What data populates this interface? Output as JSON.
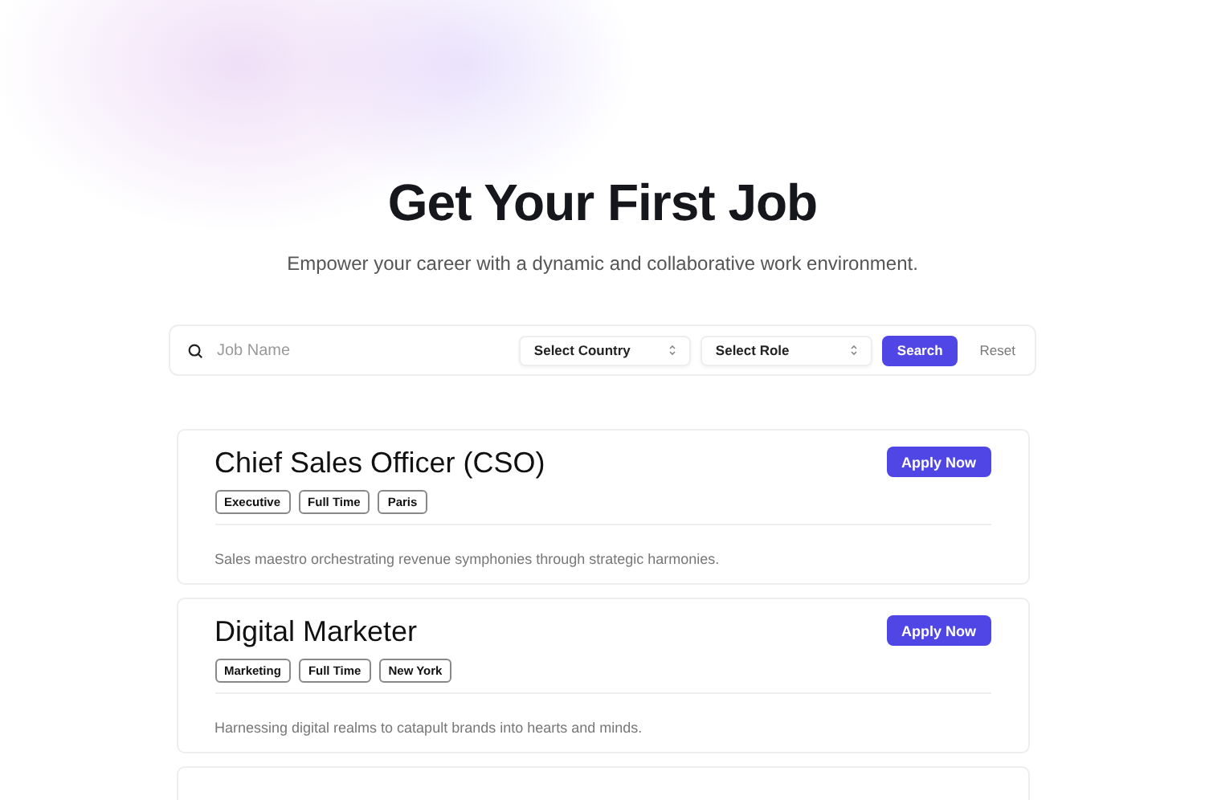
{
  "hero": {
    "title": "Get Your First Job",
    "subtitle": "Empower your career with a dynamic and collaborative work environment."
  },
  "search": {
    "placeholder": "Job Name",
    "selects": [
      "Select Country",
      "Select Role"
    ],
    "search_button": "Search",
    "reset_button": "Reset"
  },
  "jobs": [
    {
      "title": "Chief Sales Officer (CSO)",
      "tags": [
        "Executive",
        "Full Time",
        "Paris"
      ],
      "description": "Sales maestro orchestrating revenue symphonies through strategic harmonies.",
      "button": "Apply Now"
    },
    {
      "title": "Digital Marketer",
      "tags": [
        "Marketing",
        "Full Time",
        "New York"
      ],
      "description": "Harnessing digital realms to catapult brands into hearts and minds.",
      "button": "Apply Now"
    }
  ]
}
